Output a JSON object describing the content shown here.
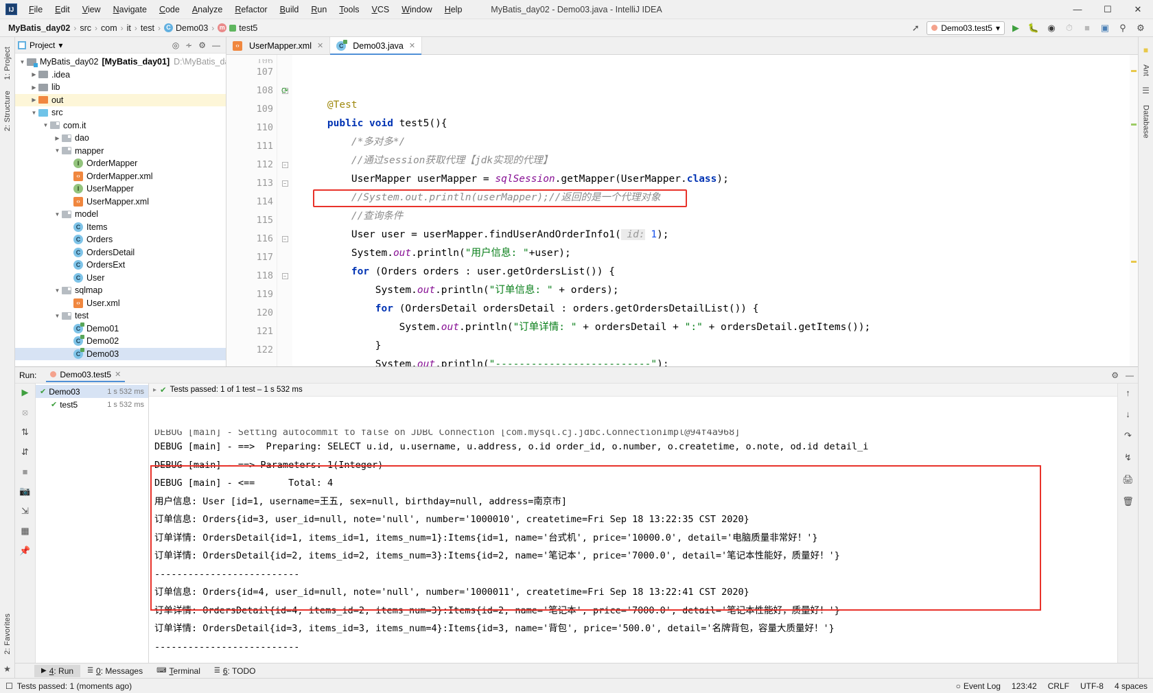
{
  "window": {
    "title": "MyBatis_day02 - Demo03.java - IntelliJ IDEA",
    "logo": "IJ",
    "minimize": "—",
    "maximize": "☐",
    "close": "✕"
  },
  "menu": [
    "File",
    "Edit",
    "View",
    "Navigate",
    "Code",
    "Analyze",
    "Refactor",
    "Build",
    "Run",
    "Tools",
    "VCS",
    "Window",
    "Help"
  ],
  "breadcrumbs": [
    {
      "label": "MyBatis_day02",
      "icon": "",
      "bold": true
    },
    {
      "label": "src",
      "icon": "",
      "bold": false
    },
    {
      "label": "com",
      "icon": "",
      "bold": false
    },
    {
      "label": "it",
      "icon": "",
      "bold": false
    },
    {
      "label": "test",
      "icon": "",
      "bold": false
    },
    {
      "label": "Demo03",
      "icon": "class-icon",
      "bold": false
    },
    {
      "label": "test5",
      "icon": "method-icon",
      "bold": false
    }
  ],
  "toolbar": {
    "run_config": "Demo03.test5",
    "dropdown_caret": "▾",
    "icons": [
      "build-icon",
      "run-icon",
      "debug-icon",
      "run-coverage-icon",
      "profile-icon",
      "stop-icon",
      "layout-icon",
      "search-everywhere-icon",
      "settings-icon"
    ]
  },
  "project_panel": {
    "title": "Project",
    "caret": "▾",
    "tools": [
      "locate-icon",
      "collapse-all-icon",
      "settings-icon",
      "hide-icon"
    ],
    "tree": [
      {
        "indent": 0,
        "arrow": "▼",
        "kind": "folder-module",
        "label": "MyBatis_day02",
        "bold_suffix": "[MyBatis_day01]",
        "path": "D:\\MyBatis_day",
        "selected": false,
        "highlight": false
      },
      {
        "indent": 1,
        "arrow": "▶",
        "kind": "folder-gray",
        "label": ".idea",
        "selected": false,
        "highlight": false
      },
      {
        "indent": 1,
        "arrow": "▶",
        "kind": "folder-gray",
        "label": "lib",
        "selected": false,
        "highlight": false
      },
      {
        "indent": 1,
        "arrow": "▶",
        "kind": "folder-orange",
        "label": "out",
        "selected": false,
        "highlight": true
      },
      {
        "indent": 1,
        "arrow": "▼",
        "kind": "folder-blue",
        "label": "src",
        "selected": false,
        "highlight": false
      },
      {
        "indent": 2,
        "arrow": "▼",
        "kind": "folder-pkg",
        "label": "com.it",
        "selected": false,
        "highlight": false
      },
      {
        "indent": 3,
        "arrow": "▶",
        "kind": "folder-pkg",
        "label": "dao",
        "selected": false,
        "highlight": false
      },
      {
        "indent": 3,
        "arrow": "▼",
        "kind": "folder-pkg",
        "label": "mapper",
        "selected": false,
        "highlight": false
      },
      {
        "indent": 4,
        "arrow": "",
        "kind": "interface",
        "label": "OrderMapper",
        "selected": false,
        "highlight": false
      },
      {
        "indent": 4,
        "arrow": "",
        "kind": "xml",
        "label": "OrderMapper.xml",
        "selected": false,
        "highlight": false
      },
      {
        "indent": 4,
        "arrow": "",
        "kind": "interface",
        "label": "UserMapper",
        "selected": false,
        "highlight": false
      },
      {
        "indent": 4,
        "arrow": "",
        "kind": "xml",
        "label": "UserMapper.xml",
        "selected": false,
        "highlight": false
      },
      {
        "indent": 3,
        "arrow": "▼",
        "kind": "folder-pkg",
        "label": "model",
        "selected": false,
        "highlight": false
      },
      {
        "indent": 4,
        "arrow": "",
        "kind": "class",
        "label": "Items",
        "selected": false,
        "highlight": false
      },
      {
        "indent": 4,
        "arrow": "",
        "kind": "class",
        "label": "Orders",
        "selected": false,
        "highlight": false
      },
      {
        "indent": 4,
        "arrow": "",
        "kind": "class",
        "label": "OrdersDetail",
        "selected": false,
        "highlight": false
      },
      {
        "indent": 4,
        "arrow": "",
        "kind": "class",
        "label": "OrdersExt",
        "selected": false,
        "highlight": false
      },
      {
        "indent": 4,
        "arrow": "",
        "kind": "class",
        "label": "User",
        "selected": false,
        "highlight": false
      },
      {
        "indent": 3,
        "arrow": "▼",
        "kind": "folder-pkg",
        "label": "sqlmap",
        "selected": false,
        "highlight": false
      },
      {
        "indent": 4,
        "arrow": "",
        "kind": "xml",
        "label": "User.xml",
        "selected": false,
        "highlight": false
      },
      {
        "indent": 3,
        "arrow": "▼",
        "kind": "folder-pkg",
        "label": "test",
        "selected": false,
        "highlight": false
      },
      {
        "indent": 4,
        "arrow": "",
        "kind": "test-class",
        "label": "Demo01",
        "selected": false,
        "highlight": false
      },
      {
        "indent": 4,
        "arrow": "",
        "kind": "test-class",
        "label": "Demo02",
        "selected": false,
        "highlight": false
      },
      {
        "indent": 4,
        "arrow": "",
        "kind": "test-class",
        "label": "Demo03",
        "selected": true,
        "highlight": false
      }
    ]
  },
  "editor": {
    "tabs": [
      {
        "label": "UserMapper.xml",
        "icon": "xml-icon",
        "active": false,
        "close": "✕"
      },
      {
        "label": "Demo03.java",
        "icon": "test-class-icon",
        "active": true,
        "close": "✕"
      }
    ],
    "first_partial_line": "106",
    "lines": [
      {
        "n": "107",
        "fold": "",
        "runmark": "",
        "html": "    <span class='anno'>@Test</span>"
      },
      {
        "n": "108",
        "fold": "minus",
        "runmark": "run-test-icon",
        "html": "    <span class='kw'>public</span> <span class='kw'>void</span> test5(){"
      },
      {
        "n": "109",
        "fold": "",
        "runmark": "",
        "html": "        <span class='cmt'>/*多对多*/</span>"
      },
      {
        "n": "110",
        "fold": "",
        "runmark": "",
        "html": "        <span class='cmt'>//通过session获取代理【jdk实现的代理】</span>"
      },
      {
        "n": "111",
        "fold": "",
        "runmark": "",
        "html": "        UserMapper userMapper = <span class='fld'>sqlSession</span>.getMapper(UserMapper.<span class='kw'>class</span>);"
      },
      {
        "n": "112",
        "fold": "minus",
        "runmark": "",
        "html": "        <span class='cmt'>//System.out.println(userMapper);//返回的是一个代理对象</span>"
      },
      {
        "n": "113",
        "fold": "minus",
        "runmark": "",
        "html": "        <span class='cmt'>//查询条件</span>"
      },
      {
        "n": "114",
        "fold": "",
        "runmark": "",
        "html": "        User user = userMapper.findUserAndOrderInfo1(<span class='hint'> id:</span> <span class='num'>1</span>);"
      },
      {
        "n": "115",
        "fold": "",
        "runmark": "",
        "html": "        System.<span class='fld'>out</span>.println(<span class='str'>\"用户信息: \"</span>+user);"
      },
      {
        "n": "116",
        "fold": "minus",
        "runmark": "",
        "html": "        <span class='kw'>for</span> (Orders orders : user.getOrdersList()) {"
      },
      {
        "n": "117",
        "fold": "",
        "runmark": "",
        "html": "            System.<span class='fld'>out</span>.println(<span class='str'>\"订单信息: \"</span> + orders);"
      },
      {
        "n": "118",
        "fold": "minus",
        "runmark": "",
        "html": "            <span class='kw'>for</span> (OrdersDetail ordersDetail : orders.getOrdersDetailList()) {"
      },
      {
        "n": "119",
        "fold": "",
        "runmark": "",
        "html": "                System.<span class='fld'>out</span>.println(<span class='str'>\"订单详情: \"</span> + ordersDetail + <span class='str'>\":\"</span> + ordersDetail.getItems());"
      },
      {
        "n": "120",
        "fold": "",
        "runmark": "",
        "html": "            }"
      },
      {
        "n": "121",
        "fold": "",
        "runmark": "",
        "html": "            System.<span class='fld'>out</span>.println(<span class='str'>\"--------------------------\"</span>);"
      },
      {
        "n": "122",
        "fold": "",
        "runmark": "",
        "html": "        }"
      }
    ]
  },
  "run_panel": {
    "label": "Run:",
    "tab": "Demo03.test5",
    "tab_close": "✕",
    "tests": [
      {
        "indent": 0,
        "check": "✔",
        "label": "Demo03",
        "time": "1 s 532 ms",
        "selected": true
      },
      {
        "indent": 1,
        "check": "✔",
        "label": "test5",
        "time": "1 s 532 ms",
        "selected": false
      }
    ],
    "status": "Tests passed: 1 of 1 test – 1 s 532 ms",
    "status_check": "✔",
    "console_clipped_line": "DEBUG [main] - Setting autocommit to false on JDBC Connection [com.mysql.cj.jdbc.ConnectionImpl@94f4a968]",
    "console_lines": [
      "DEBUG [main] - ==>  Preparing: SELECT u.id, u.username, u.address, o.id order_id, o.number, o.createtime, o.note, od.id detail_i",
      "DEBUG [main] - ==> Parameters: 1(Integer)",
      "DEBUG [main] - <==      Total: 4"
    ],
    "console_highlighted_lines": [
      "用户信息: User [id=1, username=王五, sex=null, birthday=null, address=南京市]",
      "订单信息: Orders{id=3, user_id=null, note='null', number='1000010', createtime=Fri Sep 18 13:22:35 CST 2020}",
      "订单详情: OrdersDetail{id=1, items_id=1, items_num=1}:Items{id=1, name='台式机', price='10000.0', detail='电脑质量非常好！'}",
      "订单详情: OrdersDetail{id=2, items_id=2, items_num=3}:Items{id=2, name='笔记本', price='7000.0', detail='笔记本性能好，质量好！'}",
      "--------------------------",
      "订单信息: Orders{id=4, user_id=null, note='null', number='1000011', createtime=Fri Sep 18 13:22:41 CST 2020}",
      "订单详情: OrdersDetail{id=4, items_id=2, items_num=3}:Items{id=2, name='笔记本', price='7000.0', detail='笔记本性能好，质量好！'}",
      "订单详情: OrdersDetail{id=3, items_id=3, items_num=4}:Items{id=3, name='背包', price='500.0', detail='名牌背包，容量大质量好！'}"
    ],
    "console_trailing_line": "--------------------------"
  },
  "tool_windows": [
    {
      "label": "4: Run",
      "icon": "run-icon",
      "active": true
    },
    {
      "label": "0: Messages",
      "icon": "messages-icon",
      "active": false
    },
    {
      "label": "Terminal",
      "icon": "terminal-icon",
      "active": false
    },
    {
      "label": "6: TODO",
      "icon": "todo-icon",
      "active": false
    }
  ],
  "left_strip": [
    {
      "label": "1: Project",
      "active": true
    },
    {
      "label": "2: Structure",
      "active": false
    },
    {
      "label": "2: Favorites",
      "active": false
    }
  ],
  "right_strip": [
    {
      "label": "Ant",
      "active": false
    },
    {
      "label": "Database",
      "active": false
    }
  ],
  "statusbar": {
    "message": "Tests passed: 1 (moments ago)",
    "caret": "123:42",
    "line_sep": "CRLF",
    "encoding": "UTF-8",
    "indent": "4 spaces",
    "event_log": "Event Log"
  },
  "colors": {
    "accent": "#4f8fd6",
    "highlight_box": "#e8322a",
    "selection": "#d7e3f4",
    "pass_green": "#3fa03f",
    "keyword": "#0033b3",
    "string": "#067d17",
    "comment": "#8c8c8c",
    "field": "#871094",
    "number": "#1750eb"
  }
}
